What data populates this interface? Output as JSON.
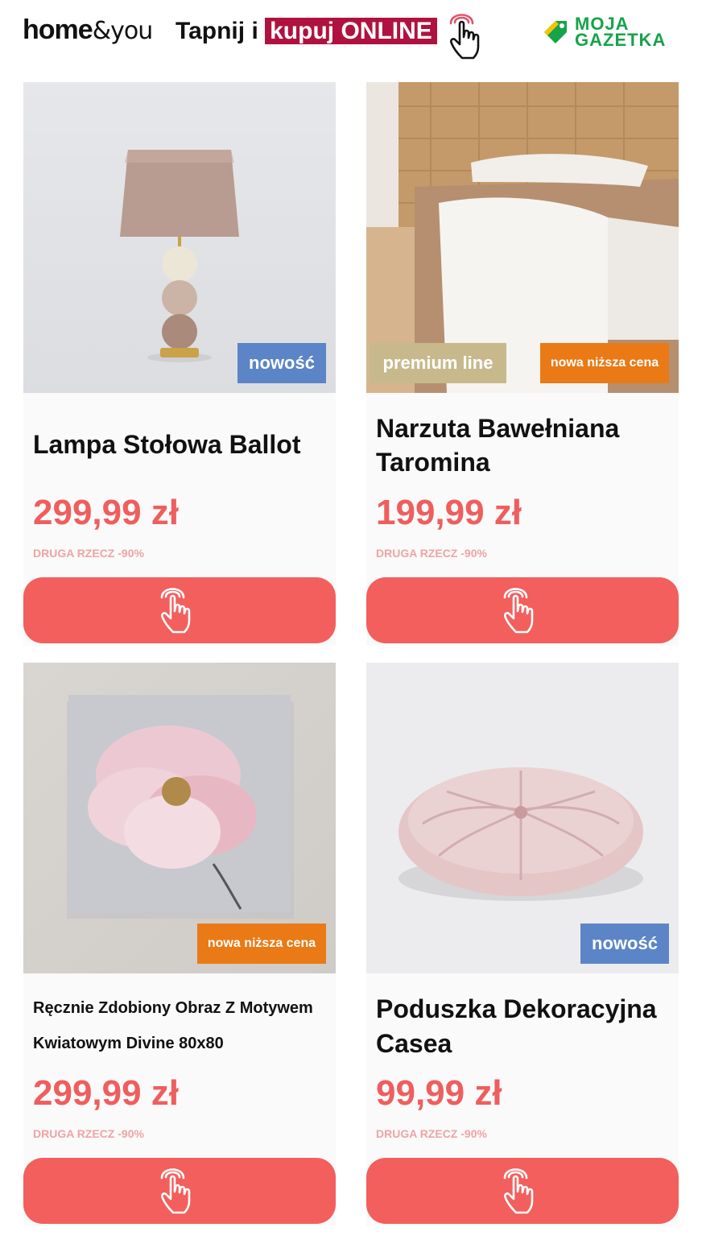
{
  "header": {
    "brand_bold": "home",
    "brand_light": "&you",
    "tagline_prefix": "Tapnij i",
    "tagline_highlight": "kupuj ONLINE",
    "logo_line1": "MOJA",
    "logo_line2": "GAZETKA"
  },
  "colors": {
    "price": "#ef5e5e",
    "cta": "#f25f5c",
    "badge_blue": "#5c85c7",
    "badge_orange": "#ea7a16",
    "badge_beige": "#c8b98d",
    "tagline_highlight": "#b0123f",
    "logo_green": "#16a34a"
  },
  "products": [
    {
      "image": "table-lamp-photo",
      "badges": [
        "nowość"
      ],
      "title_lines": [
        "Lampa Stołowa Ballot"
      ],
      "price": "299,99 zł",
      "promo": "DRUGA RZECZ -90%",
      "cta_icon": "tap-hand-icon"
    },
    {
      "image": "bedspread-photo",
      "badges": [
        "premium line",
        "nowa niższa cena"
      ],
      "title_lines": [
        "Narzuta Bawełniana",
        "Taromina"
      ],
      "price": "199,99 zł",
      "promo": "DRUGA RZECZ -90%",
      "cta_icon": "tap-hand-icon"
    },
    {
      "image": "flower-painting-photo",
      "badges": [
        "nowa niższa cena"
      ],
      "title_lines": [
        "Ręcznie Zdobiony Obraz Z Motywem",
        "Kwiatowym Divine 80x80"
      ],
      "price": "299,99 zł",
      "promo": "DRUGA RZECZ -90%",
      "cta_icon": "tap-hand-icon"
    },
    {
      "image": "round-cushion-photo",
      "badges": [
        "nowość"
      ],
      "title_lines": [
        "Poduszka Dekoracyjna",
        "Casea"
      ],
      "price": "99,99 zł",
      "promo": "DRUGA RZECZ -90%",
      "cta_icon": "tap-hand-icon"
    }
  ]
}
